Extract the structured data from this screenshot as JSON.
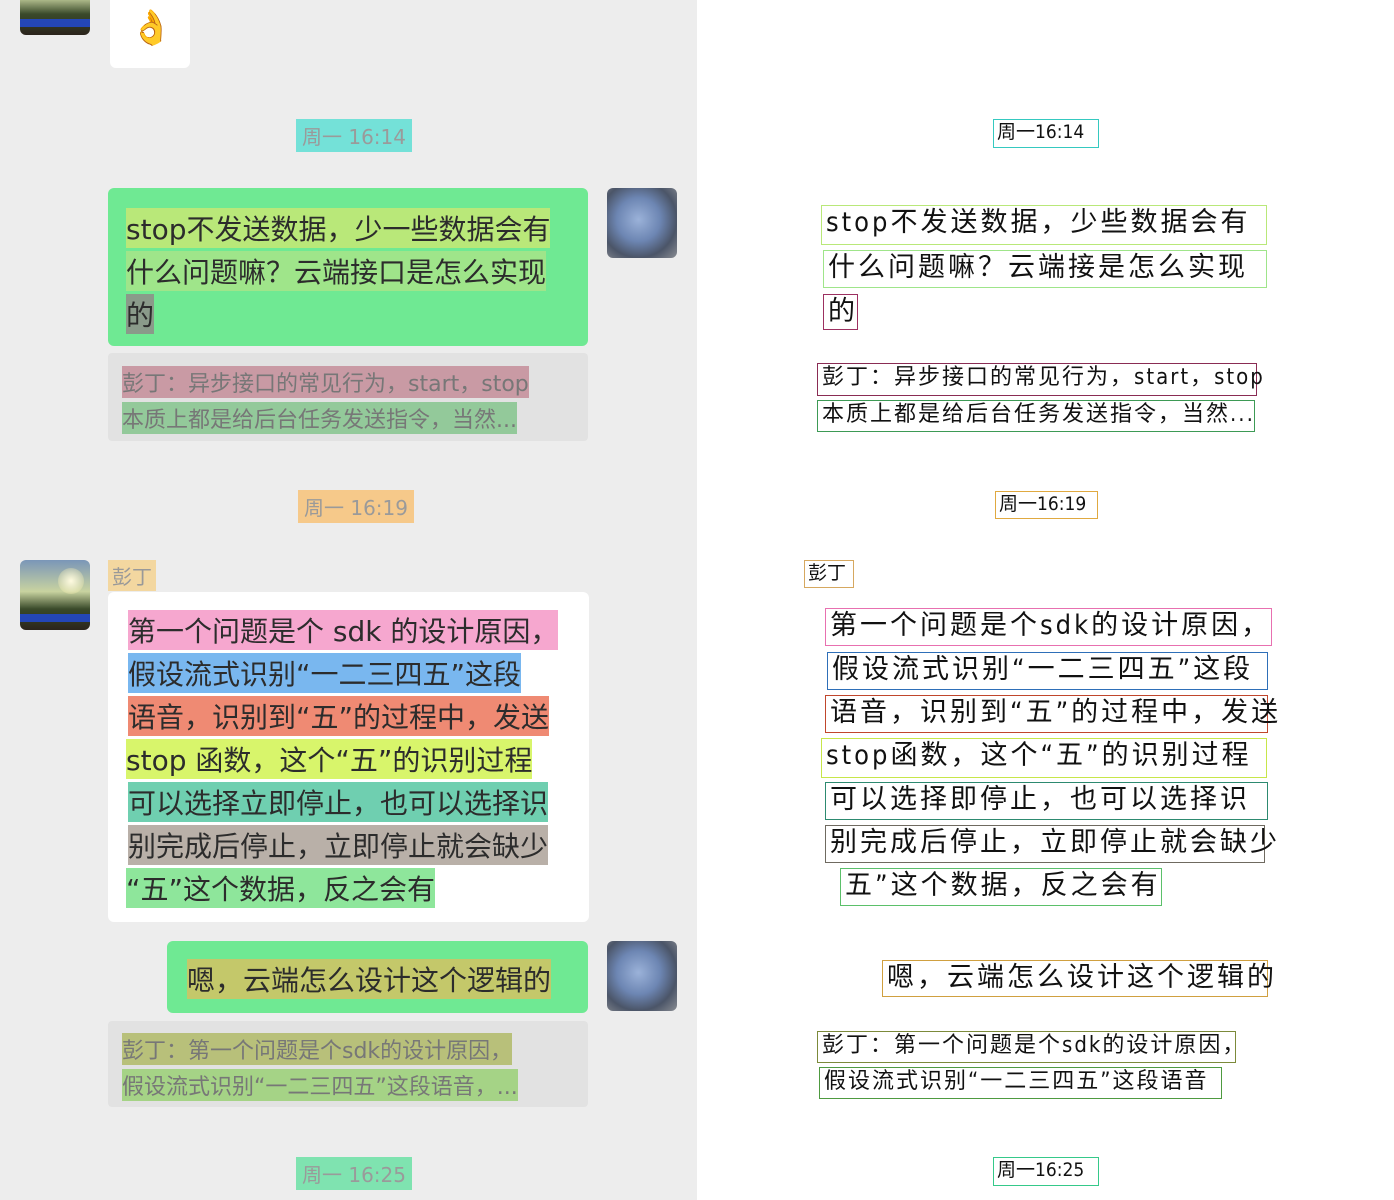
{
  "left_panel": {
    "sticker": "👌",
    "times": [
      "周一 16:14",
      "周一 16:19",
      "周一 16:25"
    ],
    "msg1_lines": [
      "stop不发送数据，少一些数据会有",
      "什么问题嘛？云端接口是怎么实现",
      "的"
    ],
    "quote1_lines": [
      "彭丁：异步接口的常见行为，start，stop",
      "本质上都是给后台任务发送指令，当然..."
    ],
    "sender_name": "彭丁",
    "msg2_lines": [
      "第一个问题是个 sdk 的设计原因，",
      "假设流式识别“一二三四五”这段",
      "语音，识别到“五”的过程中，发送",
      "stop 函数，这个“五”的识别过程",
      "可以选择立即停止，也可以选择识",
      "别完成后停止，立即停止就会缺少",
      "“五”这个数据，反之会有"
    ],
    "msg3": "嗯，云端怎么设计这个逻辑的",
    "quote2_lines": [
      "彭丁：第一个问题是个sdk的设计原因，",
      "假设流式识别“一二三四五”这段语音，..."
    ]
  },
  "right_panel": {
    "times": [
      "周一16:14",
      "周一16:19",
      "周一16:25"
    ],
    "msg1_lines": [
      "stop不发送数据，少些数据会有",
      "什么问题嘛？云端接是怎么实现",
      "的"
    ],
    "quote1_lines": [
      "彭丁：异步接口的常见行为，start，stop",
      "本质上都是给后台任务发送指令，当然..."
    ],
    "sender_name": "彭丁",
    "msg2_lines": [
      "第一个问题是个sdk的设计原因，",
      "假设流式识别“一二三四五”这段",
      "语音，识别到“五”的过程中，发送",
      "stop函数，这个“五”的识别过程",
      "可以选择即停止，也可以选择识",
      "别完成后停止，立即停止就会缺少",
      "五”这个数据，反之会有"
    ],
    "msg3": "嗯，云端怎么设计这个逻辑的",
    "quote2_lines": [
      "彭丁：第一个问题是个sdk的设计原因，",
      "假设流式识别“一二三四五”这段语音"
    ]
  },
  "colors": {
    "chat_bg": "#ededed",
    "green_bubble": "#6fe993",
    "highlight_pink": "#f6a7cf",
    "highlight_blue": "#79b7ef",
    "highlight_red": "#ef8a73",
    "highlight_lime": "#d8f56b",
    "highlight_teal": "#6fcfb0",
    "highlight_grey": "#b9b0a8",
    "highlight_green": "#8ee69b",
    "highlight_cyan": "#74e1d8",
    "highlight_orange": "#f6c98a",
    "highlight_olive": "#b8c07a"
  }
}
